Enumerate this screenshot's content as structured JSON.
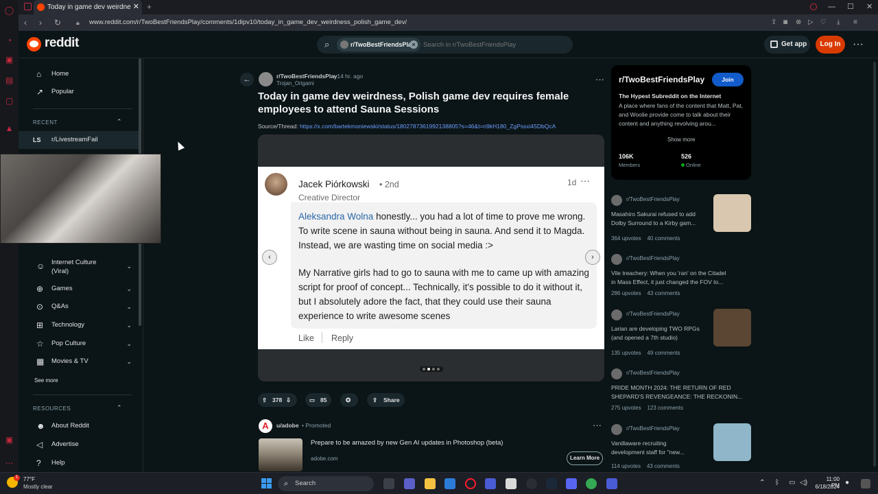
{
  "browser": {
    "tab_title": "Today in game dev weirdne",
    "tab_close": "✕",
    "new_tab": "+",
    "url": "www.reddit.com/r/TwoBestFriendsPlay/comments/1dipv10/today_in_game_dev_weirdness_polish_game_dev/",
    "win_min": "—",
    "win_max": "☐",
    "win_close": "✕"
  },
  "header": {
    "logo": "reddit",
    "search_chip": "r/TwoBestFriendsPlay",
    "search_placeholder": "Search in r/TwoBestFriendsPlay",
    "get_app": "Get app",
    "login": "Log In",
    "more": "···"
  },
  "sidebar": {
    "home": "Home",
    "popular": "Popular",
    "recent_title": "RECENT",
    "recent_item": "r/LivestreamFail",
    "topics": [
      {
        "label": "Internet Culture",
        "label2": "(Viral)"
      },
      {
        "label": "Games"
      },
      {
        "label": "Q&As"
      },
      {
        "label": "Technology"
      },
      {
        "label": "Pop Culture"
      },
      {
        "label": "Movies & TV"
      }
    ],
    "see_more": "See more",
    "resources_title": "RESOURCES",
    "resources": [
      "About Reddit",
      "Advertise",
      "Help"
    ]
  },
  "post": {
    "subreddit": "r/TwoBestFriendsPlay",
    "time": "• 14 hr. ago",
    "user": "Trojan_Origami",
    "title": "Today in game dev weirdness, Polish game dev requires female employees to attend Sauna Sessions",
    "source_label": "Source/Thread: ",
    "source_url": "https://x.com/bartekmoniewski/status/1802787361992138805?s=46&t=n9kH180_ZgPssxi45DbQcA",
    "upvotes": "378",
    "comments": "85",
    "share": "Share"
  },
  "linkedin": {
    "name": "Jacek Piórkowski",
    "degree": "• 2nd",
    "job_title": "Creative Director",
    "time": "1d",
    "mention": "Aleksandra Wolna",
    "p1": " honestly... you had a lot of time to prove me wrong. To write scene in sauna without being in sauna. And send it to Magda. Instead, we are wasting time on social media :>",
    "p2": "My Narrative girls had to go to sauna with me to came up with amazing script for proof of concept... Technically, it's possible to do it without it, but I absolutely adore the fact, that they could use their sauna experience to write awesome scenes",
    "like": "Like",
    "reply": "Reply"
  },
  "ad": {
    "user": "u/adobe",
    "promoted": "• Promoted",
    "text": "Prepare to be amazed by new Gen AI updates in Photoshop (beta)",
    "domain": "adobe.com",
    "cta": "Learn More"
  },
  "subreddit_card": {
    "name": "r/TwoBestFriendsPlay",
    "join": "Join",
    "tagline": "The Hypest Subreddit on the Internet",
    "description": "A place where fans of the content that Matt, Pat, and Woolie provide come to talk about their content and anything revolving arou...",
    "show_more": "Show more",
    "members": "106K",
    "members_label": "Members",
    "online": "526",
    "online_label": "Online"
  },
  "related_posts": [
    {
      "sub": "r/TwoBestFriendsPlay",
      "title1": "Masahiro Sakurai refused to add",
      "title2": "Dolby Surround to a Kirby gam...",
      "upvotes": "364 upvotes",
      "comments": "40 comments",
      "thumb_color": "#d9c7b0"
    },
    {
      "sub": "r/TwoBestFriendsPlay",
      "title1": "Vile treachery: When you 'ran' on the Citadel",
      "title2": "in Mass Effect, it just changed the FOV to...",
      "upvotes": "286 upvotes",
      "comments": "43 comments",
      "thumb_color": ""
    },
    {
      "sub": "r/TwoBestFriendsPlay",
      "title1": "Larian are developing TWO RPGs",
      "title2": "(and opened a 7th studio)",
      "upvotes": "135 upvotes",
      "comments": "49 comments",
      "thumb_color": "#5a4632"
    },
    {
      "sub": "r/TwoBestFriendsPlay",
      "title1": "PRIDE MONTH 2024: THE RETURN OF RED",
      "title2": "SHEPARD'S REVENGEANCE: THE RECKONIN...",
      "upvotes": "275 upvotes",
      "comments": "123 comments",
      "thumb_color": ""
    },
    {
      "sub": "r/TwoBestFriendsPlay",
      "title1": "Vanillaware recruiting",
      "title2": "development staff for \"new...",
      "upvotes": "114 upvotes",
      "comments": "43 comments",
      "thumb_color": "#8fb7c9"
    }
  ],
  "taskbar": {
    "temp": "77°F",
    "weather": "Mostly clear",
    "weather_badge": "1",
    "search": "Search",
    "time": "11:00 PM",
    "date": "6/18/2024"
  },
  "colors": {
    "reddit_orange": "#ff4500",
    "login_bg": "#d93a00",
    "join_bg": "#115bca",
    "link_blue": "#6d9fff",
    "linkedin_mention": "#2a66a8"
  }
}
